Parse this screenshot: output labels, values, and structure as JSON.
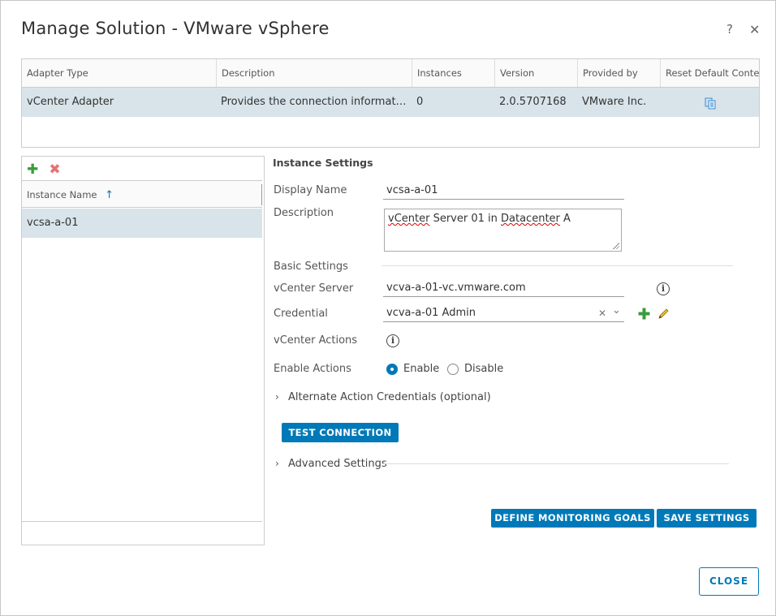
{
  "dialog": {
    "title": "Manage Solution - VMware vSphere",
    "help_label": "?",
    "close_label": "✕"
  },
  "adapter_table": {
    "columns": [
      "Adapter Type",
      "Description",
      "Instances",
      "Version",
      "Provided by",
      "Reset Default Content"
    ],
    "rows": [
      {
        "adapter_type": "vCenter Adapter",
        "description": "Provides the connection informatio…",
        "instances": "0",
        "version": "2.0.5707168",
        "provided_by": "VMware Inc."
      }
    ]
  },
  "instances_panel": {
    "add_label": "✚",
    "delete_label": "✖",
    "column": "Instance Name",
    "sort_glyph": "↑",
    "rows": [
      "vcsa-a-01"
    ]
  },
  "instance_settings": {
    "section_title": "Instance Settings",
    "display_name_label": "Display Name",
    "display_name_value": "vcsa-a-01",
    "description_label": "Description",
    "description_prefix": "vCenter",
    "description_mid": " Server 01 in ",
    "description_word": "Datacenter",
    "description_suffix": " A",
    "basic_settings_label": "Basic Settings",
    "vcenter_server_label": "vCenter Server",
    "vcenter_server_value": "vcva-a-01-vc.vmware.com",
    "credential_label": "Credential",
    "credential_value": "vcva-a-01 Admin",
    "credential_clear": "✕",
    "credential_caret": "⌄",
    "vcenter_actions_label": "vCenter Actions",
    "enable_actions_label": "Enable Actions",
    "enable_option": "Enable",
    "disable_option": "Disable",
    "alternate_credentials": "Alternate Action Credentials (optional)",
    "test_connection": "TEST CONNECTION",
    "advanced_settings": "Advanced Settings",
    "info_glyph": "i",
    "expand_glyph": "›"
  },
  "actions": {
    "define_goals": "DEFINE MONITORING GOALS",
    "save_settings": "SAVE SETTINGS",
    "close": "CLOSE"
  },
  "colors": {
    "accent": "#0079b8",
    "selected_row": "#d9e4ea",
    "add_green": "#3c9b3c",
    "delete_red": "#e57373"
  }
}
